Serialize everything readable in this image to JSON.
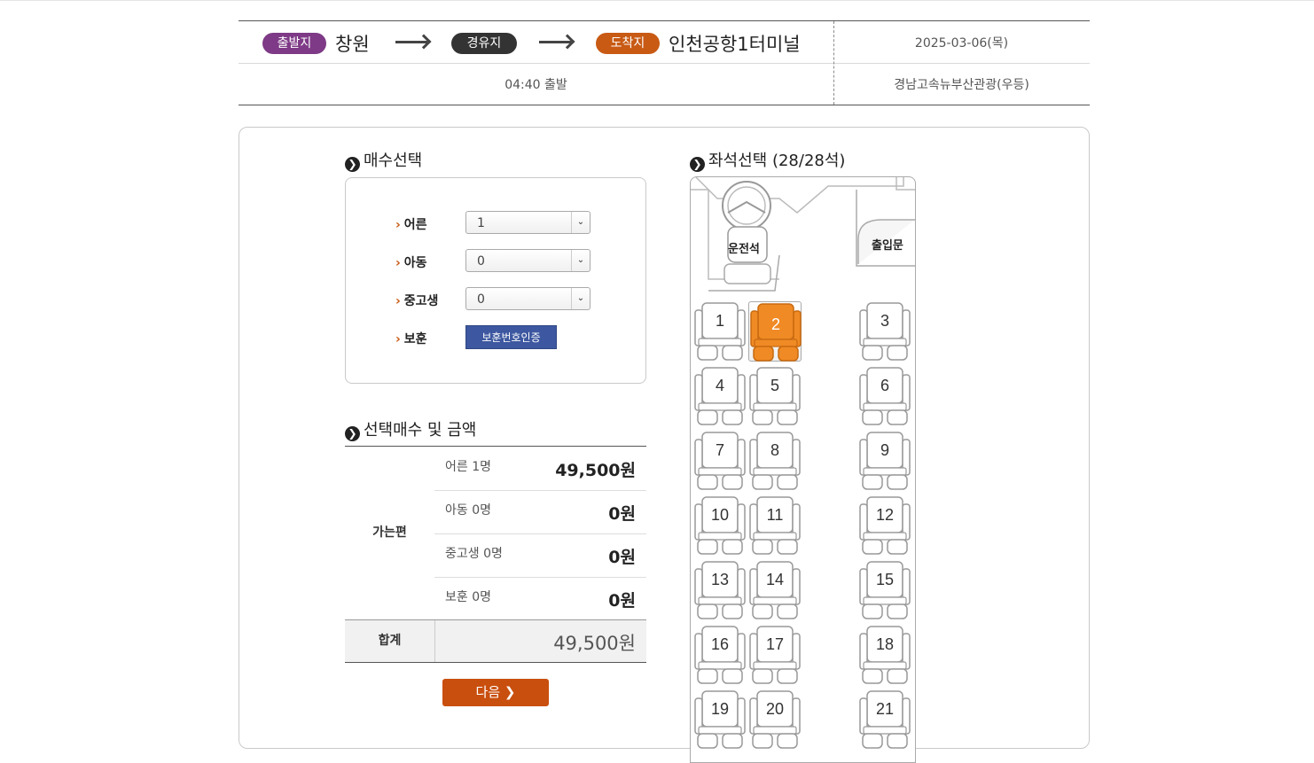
{
  "route": {
    "departure_tag": "출발지",
    "departure": "창원",
    "via_tag": "경유지",
    "arrival_tag": "도착지",
    "arrival": "인천공항1터미널",
    "date": "2025-03-06(목)",
    "departure_time": "04:40 출발",
    "company": "경남고속뉴부산관광(우등)"
  },
  "quantity": {
    "title": "매수선택",
    "adult_label": "어른",
    "adult_value": "1",
    "child_label": "아동",
    "child_value": "0",
    "student_label": "중고생",
    "student_value": "0",
    "veteran_label": "보훈",
    "veteran_button": "보훈번호인증"
  },
  "fare": {
    "title": "선택매수 및 금액",
    "trip_label": "가는편",
    "rows": [
      {
        "label": "어른 1명",
        "value": "49,500원"
      },
      {
        "label": "아동 0명",
        "value": "0원"
      },
      {
        "label": "중고생 0명",
        "value": "0원"
      },
      {
        "label": "보훈 0명",
        "value": "0원"
      }
    ],
    "total_label": "합계",
    "total_value": "49,500원",
    "next_button": "다음"
  },
  "seatmap": {
    "title": "좌석선택 (28/28석)",
    "driver_label": "운전석",
    "door_label": "출입문",
    "selected_color": "#f08a24",
    "selected": [
      "2"
    ],
    "seats": [
      "1",
      "2",
      "3",
      "4",
      "5",
      "6",
      "7",
      "8",
      "9",
      "10",
      "11",
      "12",
      "13",
      "14",
      "15",
      "16",
      "17",
      "18",
      "19",
      "20",
      "21"
    ]
  }
}
